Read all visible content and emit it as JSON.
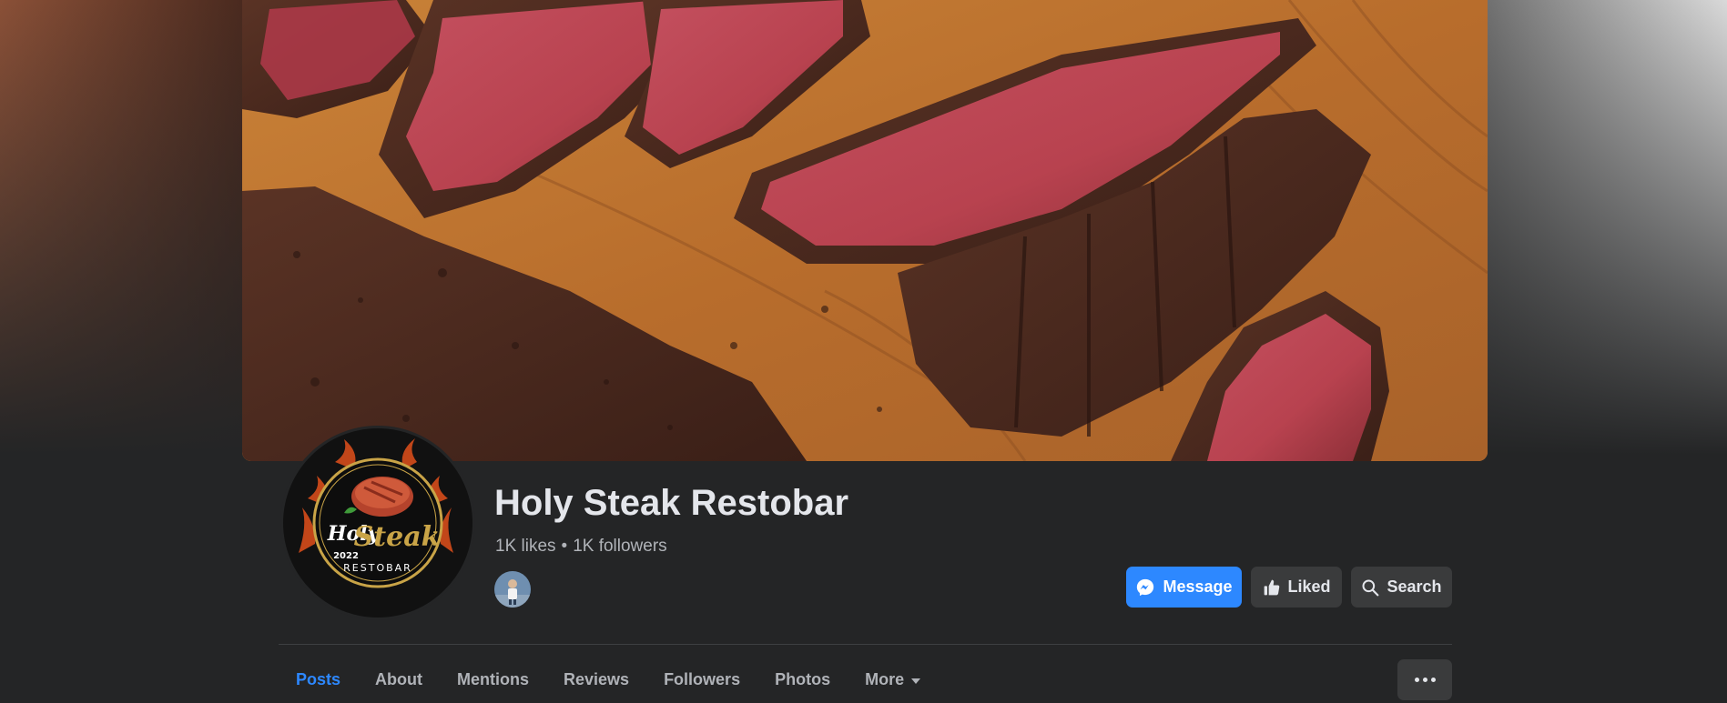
{
  "page": {
    "name": "Holy Steak Restobar",
    "likes": "1K likes",
    "separator": "•",
    "followers": "1K followers"
  },
  "logo": {
    "text_top": "Holy",
    "text_script": "Steak",
    "year": "2022",
    "text_bottom": "RESTOBAR"
  },
  "actions": {
    "message_label": "Message",
    "liked_label": "Liked",
    "search_label": "Search"
  },
  "tabs": [
    {
      "label": "Posts",
      "active": true
    },
    {
      "label": "About"
    },
    {
      "label": "Mentions"
    },
    {
      "label": "Reviews"
    },
    {
      "label": "Followers"
    },
    {
      "label": "Photos"
    },
    {
      "label": "More"
    }
  ],
  "icons": {
    "message": "messenger-icon",
    "liked": "thumbs-up-icon",
    "search": "search-icon",
    "more": "caret-down-icon",
    "options": "ellipsis-icon"
  },
  "colors": {
    "accent": "#2d88ff",
    "background": "#242526",
    "button": "#3a3b3c",
    "text": "#e4e6eb",
    "secondary_text": "#b0b3b8"
  }
}
